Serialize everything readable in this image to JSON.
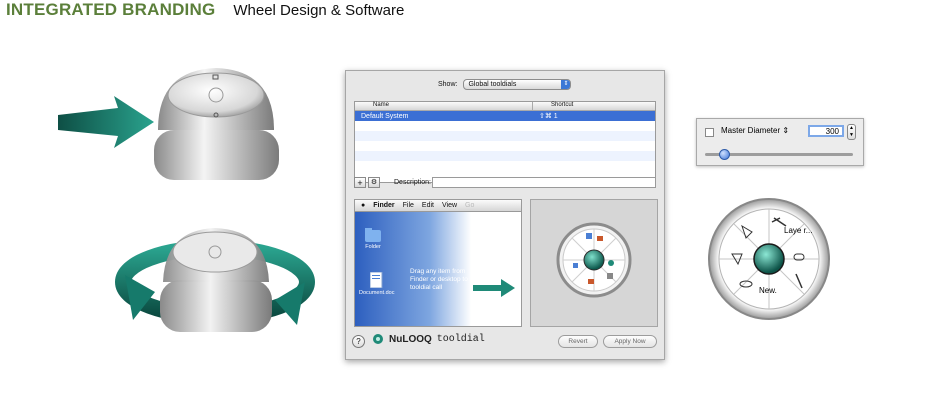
{
  "header": {
    "title": "INTEGRATED BRANDING",
    "subtitle": "Wheel Design & Software"
  },
  "prefs_window": {
    "show_label": "Show:",
    "show_value": "Global tooldials",
    "columns": [
      "Name",
      "Shortcut"
    ],
    "rows": [
      {
        "name": "Default System",
        "shortcut": "⇧⌘ 1"
      }
    ],
    "add_label": "+",
    "gear_label": "⚙",
    "description_label": "Description:",
    "finder_menu": [
      "Finder",
      "File",
      "Edit",
      "View",
      "Go"
    ],
    "drag_hint": "Drag any item from Finder or desktop to tooldial call",
    "icons": [
      "Folder",
      "Document.doc"
    ],
    "brand": "NuLOOQ",
    "brand_product": "tooldial",
    "help_label": "?",
    "revert_label": "Revert",
    "apply_label": "Apply Now"
  },
  "diameter_panel": {
    "label": "Master Diameter ⇕",
    "value": "300",
    "slider_fraction": 0.12
  },
  "wheel_large": {
    "labels": [
      "Laye r...",
      "New."
    ]
  },
  "colors": {
    "brand_green": "#5b7f3a",
    "teal": "#1f8a78",
    "selection_blue": "#3b6fd4"
  }
}
